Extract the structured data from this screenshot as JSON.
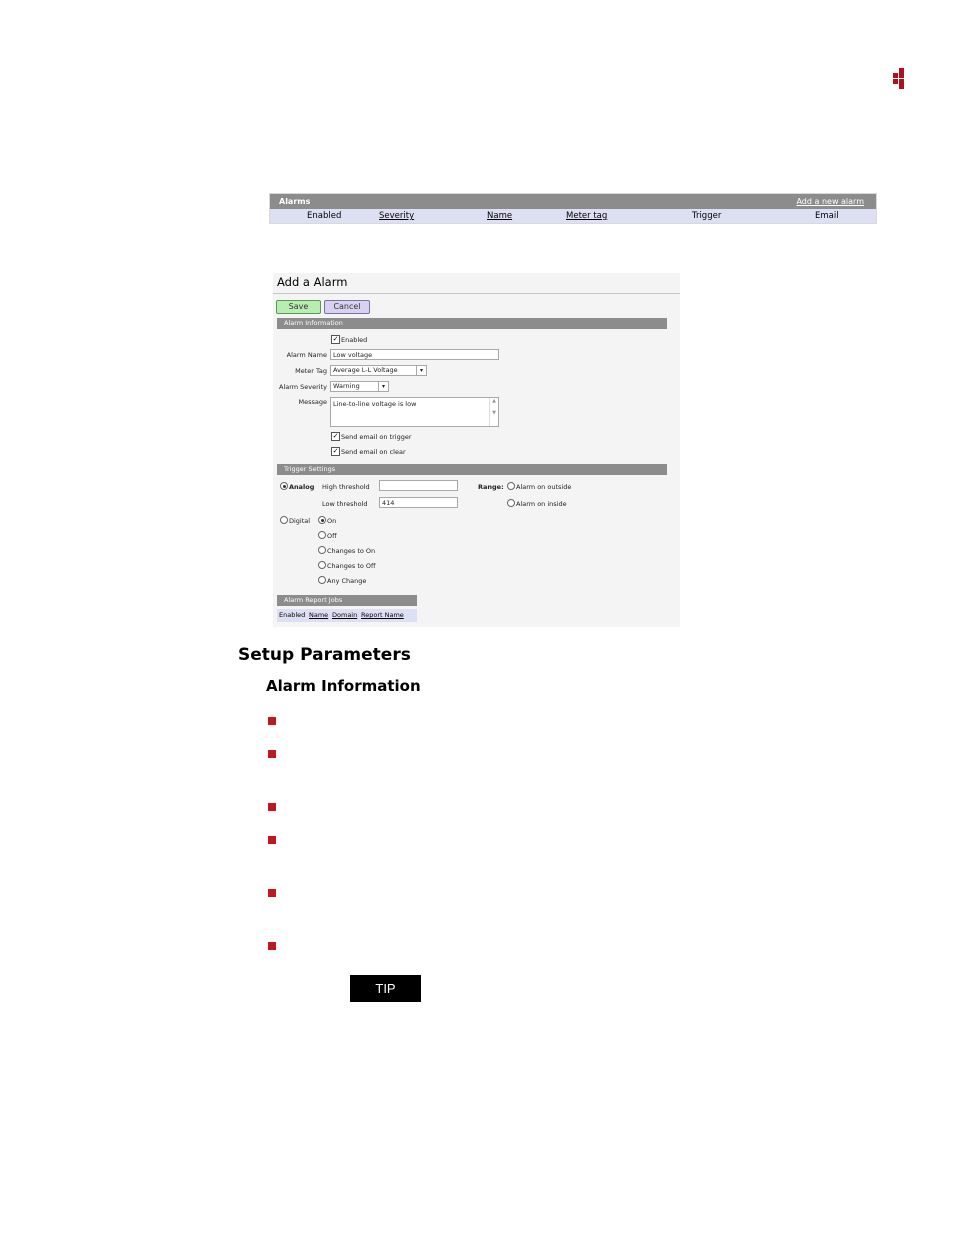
{
  "alarms_table": {
    "title": "Alarms",
    "add_link": "Add a new alarm",
    "columns": [
      "Enabled",
      "Severity",
      "Name",
      "Meter tag",
      "Trigger",
      "Email"
    ]
  },
  "add_alarm": {
    "title": "Add a Alarm",
    "save_label": "Save",
    "cancel_label": "Cancel",
    "alarm_info_header": "Alarm Information",
    "enabled_label": "Enabled",
    "alarm_name_label": "Alarm Name",
    "alarm_name_value": "Low voltage",
    "meter_tag_label": "Meter Tag",
    "meter_tag_value": "Average L-L Voltage",
    "severity_label": "Alarm Severity",
    "severity_value": "Warning",
    "message_label": "Message",
    "message_value": "Line-to-line voltage is low",
    "send_trigger_label": "Send email on trigger",
    "send_clear_label": "Send email on clear",
    "trigger_header": "Trigger Settings",
    "analog_label": "Analog",
    "high_threshold_label": "High threshold",
    "high_threshold_value": "",
    "low_threshold_label": "Low threshold",
    "low_threshold_value": "414",
    "range_label": "Range:",
    "range_outside_label": "Alarm on outside",
    "range_inside_label": "Alarm on inside",
    "digital_label": "Digital",
    "digital_options": [
      "On",
      "Off",
      "Changes to On",
      "Changes to Off",
      "Any Change"
    ],
    "report_jobs_header": "Alarm Report Jobs",
    "report_jobs_columns": [
      "Enabled",
      "Name",
      "Domain",
      "Report Name"
    ]
  },
  "doc": {
    "heading": "Setup Parameters",
    "subheading": "Alarm Information",
    "tip_label": "TIP"
  },
  "colors": {
    "accent_red": "#c01822",
    "header_gray": "#8c8c8c",
    "row_lavender": "#dde0f5"
  }
}
